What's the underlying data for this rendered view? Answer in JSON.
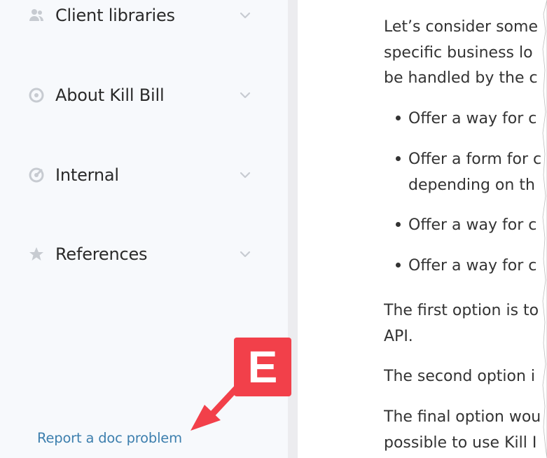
{
  "sidebar": {
    "items": [
      {
        "label": "Client libraries",
        "icon": "users-icon"
      },
      {
        "label": "About Kill Bill",
        "icon": "about-icon"
      },
      {
        "label": "Internal",
        "icon": "internal-icon"
      },
      {
        "label": "References",
        "icon": "star-icon"
      }
    ],
    "report_link": "Report a doc problem"
  },
  "content": {
    "para1": [
      "Let’s consider some",
      "specific business lo",
      "be handled by the c"
    ],
    "bullets": [
      [
        "Offer a way for c"
      ],
      [
        "Offer a form for c",
        "depending on th"
      ],
      [
        "Offer a way for c"
      ],
      [
        "Offer a way for c"
      ]
    ],
    "para2": [
      "The first option is to",
      "API."
    ],
    "para3": [
      "The second option i"
    ],
    "para4": [
      "The final option wou",
      "possible to use Kill I"
    ]
  },
  "callout": {
    "label": "E",
    "color": "#f2404a"
  },
  "colors": {
    "link": "#3d7fae",
    "sidebar_bg": "#f7f9fc",
    "icon": "#c7cbd1"
  }
}
